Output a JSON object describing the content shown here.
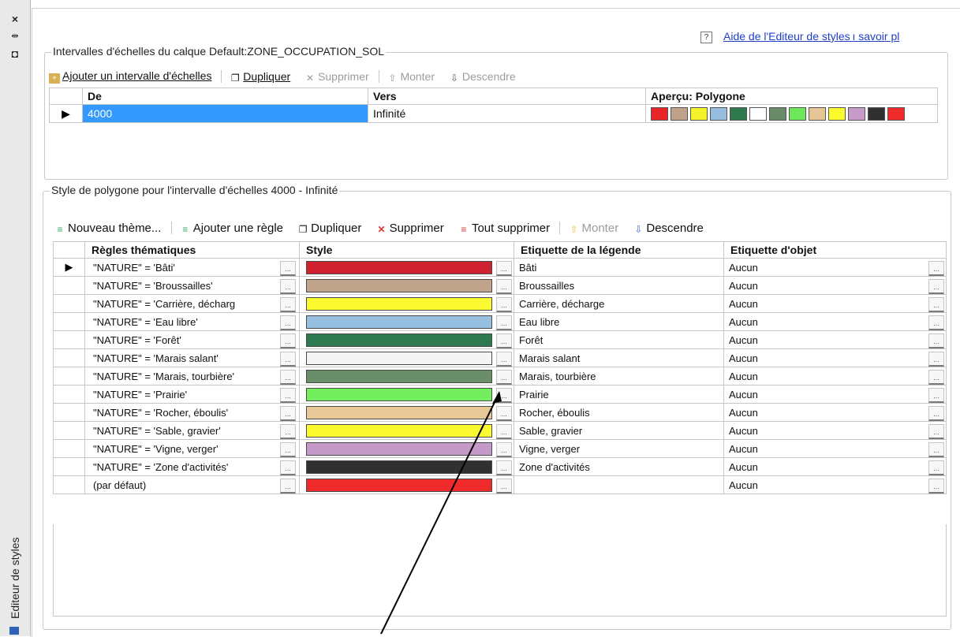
{
  "sidebar": {
    "close_icon": "×",
    "pin_icon": "⇹",
    "panel_icon": "◘",
    "title": "Editeur de styles"
  },
  "help": {
    "icon": "?",
    "link": "Aide de l'Editeur de styles ı savoir pl"
  },
  "scale_group": {
    "title": "Intervalles d'échelles du calque Default:ZONE_OCCUPATION_SOL",
    "toolbar": {
      "add": "Ajouter un intervalle d'échelles",
      "duplicate": "Dupliquer",
      "delete": "Supprimer",
      "up": "Monter",
      "down": "Descendre"
    },
    "columns": [
      "De",
      "Vers",
      "Aperçu: Polygone"
    ],
    "row": {
      "from": "4000",
      "to": "Infinité"
    },
    "preview_colors": [
      "#e8262a",
      "#bfa28a",
      "#f4f22a",
      "#97bedf",
      "#2e7a4e",
      "#ffffff",
      "#6a8b6a",
      "#6de85a",
      "#e6c695",
      "#fbfa2e",
      "#c79bc9",
      "#303030",
      "#ee2a2a"
    ]
  },
  "style_group": {
    "title": "Style de polygone pour l'intervalle d'échelles 4000 - Infinité",
    "toolbar": {
      "new_theme": "Nouveau thème...",
      "add_rule": "Ajouter une règle",
      "duplicate": "Dupliquer",
      "delete": "Supprimer",
      "delete_all": "Tout supprimer",
      "up": "Monter",
      "down": "Descendre"
    },
    "columns": [
      "Règles thématiques",
      "Style",
      "Etiquette de la légende",
      "Etiquette d'objet"
    ],
    "rows": [
      {
        "rule": "\"NATURE\" = 'Bâti'",
        "color": "#d02130",
        "legend": "Bâti",
        "object": "Aucun"
      },
      {
        "rule": "\"NATURE\" = 'Broussailles'",
        "color": "#c0a48b",
        "legend": "Broussailles",
        "object": "Aucun"
      },
      {
        "rule": "\"NATURE\" =  'Carrière, décharg",
        "color": "#fbf92f",
        "legend": "Carrière, décharge",
        "object": "Aucun"
      },
      {
        "rule": "\"NATURE\" = 'Eau libre'",
        "color": "#96bfe0",
        "legend": "Eau libre",
        "object": "Aucun"
      },
      {
        "rule": "\"NATURE\" = 'Forêt'",
        "color": "#2d7a50",
        "legend": "Forêt",
        "object": "Aucun"
      },
      {
        "rule": "\"NATURE\" = 'Marais salant'",
        "color": "#f4f4f4",
        "legend": "Marais salant",
        "object": "Aucun"
      },
      {
        "rule": "\"NATURE\" = 'Marais, tourbière'",
        "color": "#6a8e6a",
        "legend": "Marais, tourbière",
        "object": "Aucun"
      },
      {
        "rule": "\"NATURE\" = 'Prairie'",
        "color": "#72ee5e",
        "legend": "Prairie",
        "object": "Aucun"
      },
      {
        "rule": "\"NATURE\" = 'Rocher, éboulis'",
        "color": "#e7c897",
        "legend": "Rocher, éboulis",
        "object": "Aucun"
      },
      {
        "rule": "\"NATURE\" = 'Sable, gravier'",
        "color": "#fbf930",
        "legend": "Sable, gravier",
        "object": "Aucun"
      },
      {
        "rule": "\"NATURE\" = 'Vigne, verger'",
        "color": "#c59ac8",
        "legend": "Vigne, verger",
        "object": "Aucun"
      },
      {
        "rule": "\"NATURE\" = 'Zone d'activités'",
        "color": "#303030",
        "legend": "Zone d'activités",
        "object": "Aucun"
      },
      {
        "rule": "(par défaut)",
        "color": "#ee2a2a",
        "legend": "",
        "object": "Aucun"
      }
    ]
  },
  "dots_label": "..."
}
